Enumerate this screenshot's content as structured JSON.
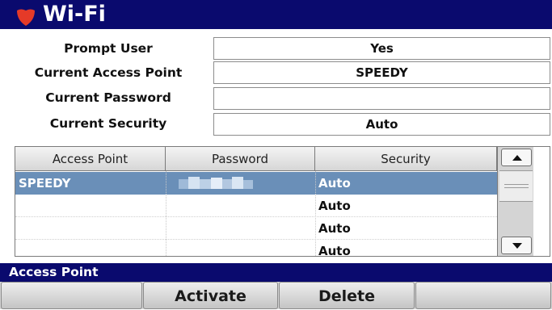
{
  "window": {
    "title": "Wi-Fi",
    "accent_color": "#0a0a6e",
    "icon": "shield-icon"
  },
  "settings": {
    "prompt_user": {
      "label": "Prompt User",
      "value": "Yes"
    },
    "current_access_point": {
      "label": "Current Access Point",
      "value": "SPEEDY"
    },
    "current_password": {
      "label": "Current Password",
      "value": ""
    },
    "current_security": {
      "label": "Current Security",
      "value": "Auto"
    }
  },
  "table": {
    "columns": [
      "Access Point",
      "Password",
      "Security"
    ],
    "rows": [
      {
        "access_point": "SPEEDY",
        "password": "",
        "security": "Auto",
        "selected": true
      },
      {
        "access_point": "",
        "password": "",
        "security": "Auto",
        "selected": false
      },
      {
        "access_point": "",
        "password": "",
        "security": "Auto",
        "selected": false
      },
      {
        "access_point": "",
        "password": "",
        "security": "Auto",
        "selected": false
      }
    ],
    "selected_color": "#6a8fb8"
  },
  "status": {
    "text": "Access Point"
  },
  "softkeys": [
    "",
    "Activate",
    "Delete",
    "",
    ""
  ]
}
